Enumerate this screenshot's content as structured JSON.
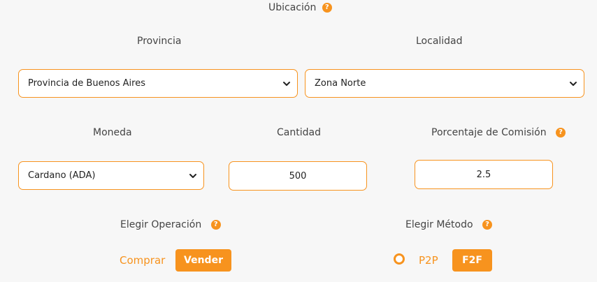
{
  "location": {
    "title": "Ubicación",
    "province_label": "Provincia",
    "province_value": "Provincia de Buenos Aires",
    "locality_label": "Localidad",
    "locality_value": "Zona Norte"
  },
  "trade": {
    "currency_label": "Moneda",
    "currency_value": "Cardano (ADA)",
    "amount_label": "Cantidad",
    "amount_value": "500",
    "commission_label": "Porcentaje de Comisión",
    "commission_value": "2.5"
  },
  "operation": {
    "label": "Elegir Operación",
    "buy_label": "Comprar",
    "sell_label": "Vender"
  },
  "method": {
    "label": "Elegir Método",
    "p2p_label": "P2P",
    "f2f_label": "F2F"
  },
  "icons": {
    "help": "question-circle-icon",
    "dropdown": "chevron-down-icon",
    "radio": "radio-ring-icon"
  },
  "colors": {
    "accent": "#f7931e",
    "background": "#f7f7f7"
  }
}
